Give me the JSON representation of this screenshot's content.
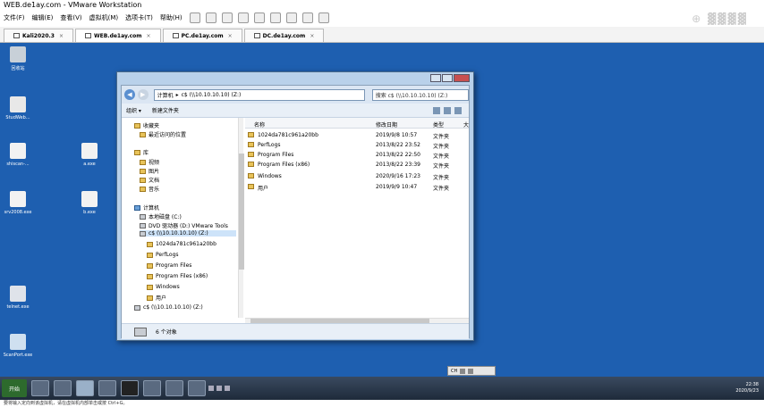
{
  "vmware": {
    "title": "WEB.de1ay.com - VMware Workstation",
    "menu": [
      "文件(F)",
      "编辑(E)",
      "查看(V)",
      "虚拟机(M)",
      "选项卡(T)",
      "帮助(H)"
    ],
    "tabs": [
      "Kali2020.3",
      "WEB.de1ay.com",
      "PC.de1ay.com",
      "DC.de1ay.com"
    ],
    "tab_close": "×",
    "status": "要将输入定向到该虚拟机，请在虚拟机内部单击或按 Ctrl+G。"
  },
  "desktop": {
    "icons": [
      {
        "label": "回收站"
      },
      {
        "label": "StudWeb..."
      },
      {
        "label": "shiscan-..."
      },
      {
        "label": "a.exe"
      },
      {
        "label": "srv2008.exe"
      },
      {
        "label": "b.exe"
      },
      {
        "label": "telnet.exe"
      },
      {
        "label": "ScanPort.exe"
      }
    ]
  },
  "explorer": {
    "address": [
      "计算机",
      "c$ (\\\\10.10.10.10) (Z:)"
    ],
    "search_placeholder": "搜索 c$ (\\\\10.10.10.10) (Z:)",
    "commands": [
      "组织 ▾",
      "新建文件夹"
    ],
    "nav": {
      "favorites": "收藏夹",
      "recent": "最近访问的位置",
      "libraries": "库",
      "videos": "视频",
      "pictures": "图片",
      "documents": "文档",
      "music": "音乐",
      "computer": "计算机",
      "local_disk": "本地磁盘 (C:)",
      "dvd": "DVD 驱动器 (D:) VMware Tools",
      "share": "c$ (\\\\10.10.10.10) (Z:)",
      "sub": [
        "1024da781c961a20bb",
        "PerfLogs",
        "Program Files",
        "Program Files (x86)",
        "Windows",
        "用户"
      ],
      "share2": "c$ (\\\\10.10.10.10) (Z:)"
    },
    "columns": {
      "name": "名称",
      "date": "修改日期",
      "type": "类型",
      "size": "大"
    },
    "files": [
      {
        "name": "1024da781c961a20bb",
        "date": "2019/9/8 10:57",
        "type": "文件夹"
      },
      {
        "name": "PerfLogs",
        "date": "2013/8/22 23:52",
        "type": "文件夹"
      },
      {
        "name": "Program Files",
        "date": "2013/8/22 22:50",
        "type": "文件夹"
      },
      {
        "name": "Program Files (x86)",
        "date": "2013/8/22 23:39",
        "type": "文件夹"
      },
      {
        "name": "Windows",
        "date": "2020/9/16 17:23",
        "type": "文件夹"
      },
      {
        "name": "用户",
        "date": "2019/9/9 10:47",
        "type": "文件夹"
      }
    ],
    "status": "6 个对象"
  },
  "taskbar": {
    "start": "开始",
    "time": "22:38",
    "date": "2020/9/23",
    "ime": "CH"
  },
  "colors": {
    "desktop": "#1e5fb0",
    "window_frame": "#b9d1ea"
  }
}
